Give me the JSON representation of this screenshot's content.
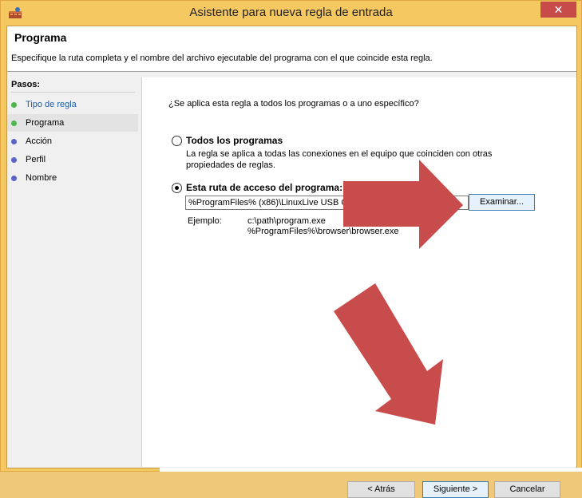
{
  "window": {
    "title": "Asistente para nueva regla de entrada",
    "close_glyph": "✕"
  },
  "header": {
    "title": "Programa",
    "description": "Especifique la ruta completa y el nombre del archivo ejecutable del programa con el que coincide esta regla."
  },
  "steps": {
    "title": "Pasos:",
    "items": [
      {
        "label": "Tipo de regla",
        "state": "done",
        "dot_color": "#4cb54c"
      },
      {
        "label": "Programa",
        "state": "current",
        "dot_color": "#4cb54c"
      },
      {
        "label": "Acción",
        "state": "pending",
        "dot_color": "#5a63c8"
      },
      {
        "label": "Perfil",
        "state": "pending",
        "dot_color": "#5a63c8"
      },
      {
        "label": "Nombre",
        "state": "pending",
        "dot_color": "#5a63c8"
      }
    ]
  },
  "main": {
    "question": "¿Se aplica esta regla a todos los programas o a uno específico?",
    "option_all": {
      "label": "Todos los programas",
      "description": "La regla se aplica a todas las conexiones en el equipo que coinciden con otras propiedades de reglas.",
      "selected": false
    },
    "option_path": {
      "label": "Esta ruta de acceso del programa:",
      "selected": true,
      "value": "%ProgramFiles% (x86)\\LinuxLive USB Creator\\LiLi USB Creator.exe",
      "browse_label": "Examinar..."
    },
    "example": {
      "label": "Ejemplo:",
      "lines": [
        "c:\\path\\program.exe",
        "%ProgramFiles%\\browser\\browser.exe"
      ]
    }
  },
  "footer": {
    "back_label": "< Atrás",
    "next_label": "Siguiente >",
    "cancel_label": "Cancelar"
  },
  "colors": {
    "titlebar": "#f6c862",
    "close": "#c74b48",
    "annotation_arrow": "#c94c4c"
  }
}
